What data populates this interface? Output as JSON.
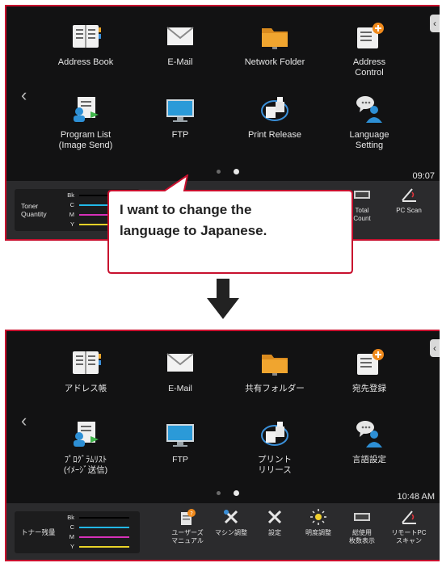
{
  "top_screen": {
    "tiles": [
      {
        "label": "Address Book",
        "icon": "address-book-icon"
      },
      {
        "label": "E-Mail",
        "icon": "email-icon"
      },
      {
        "label": "Network Folder",
        "icon": "network-folder-icon"
      },
      {
        "label": "Address\nControl",
        "icon": "address-control-icon"
      },
      {
        "label": "Program List\n(Image Send)",
        "icon": "program-list-icon"
      },
      {
        "label": "FTP",
        "icon": "ftp-icon"
      },
      {
        "label": "Print Release",
        "icon": "print-release-icon"
      },
      {
        "label": "Language\nSetting",
        "icon": "language-setting-icon"
      }
    ],
    "time": "09:07",
    "toner": {
      "title": "Toner\nQuantity",
      "channels": [
        "Bk",
        "C",
        "M",
        "Y"
      ]
    },
    "bar_buttons": [
      {
        "label": "Total\nCount",
        "icon": "counter-icon"
      },
      {
        "label": "PC Scan",
        "icon": "pc-scan-icon"
      }
    ]
  },
  "callout": {
    "text": "I want to change the\nlanguage to Japanese."
  },
  "bottom_screen": {
    "tiles": [
      {
        "label": "アドレス帳",
        "icon": "address-book-icon"
      },
      {
        "label": "E-Mail",
        "icon": "email-icon"
      },
      {
        "label": "共有フォルダー",
        "icon": "network-folder-icon"
      },
      {
        "label": "宛先登録",
        "icon": "address-control-icon"
      },
      {
        "label": "ﾌﾟﾛｸﾞﾗﾑﾘｽﾄ\n(ｲﾒｰｼﾞ送信)",
        "icon": "program-list-icon"
      },
      {
        "label": "FTP",
        "icon": "ftp-icon"
      },
      {
        "label": "プリント\nリリース",
        "icon": "print-release-icon"
      },
      {
        "label": "言語設定",
        "icon": "language-setting-icon"
      }
    ],
    "time": "10:48 AM",
    "toner": {
      "title": "トナー残量",
      "channels": [
        "Bk",
        "C",
        "M",
        "Y"
      ]
    },
    "bar_buttons": [
      {
        "label": "ユーザーズ\nマニュアル",
        "icon": "user-manual-icon"
      },
      {
        "label": "マシン調整",
        "icon": "machine-adjust-icon"
      },
      {
        "label": "設定",
        "icon": "settings-icon"
      },
      {
        "label": "明度調整",
        "icon": "brightness-icon"
      },
      {
        "label": "総使用\n枚数表示",
        "icon": "counter-icon"
      },
      {
        "label": "リモートPC\nスキャン",
        "icon": "pc-scan-icon"
      }
    ]
  },
  "colors": {
    "frame": "#c8102e",
    "toner_bk": "#111111",
    "toner_c": "#22b8e8",
    "toner_m": "#d630b8",
    "toner_y": "#e8d228",
    "callout_border": "#c8102e",
    "arrow": "#222222"
  }
}
